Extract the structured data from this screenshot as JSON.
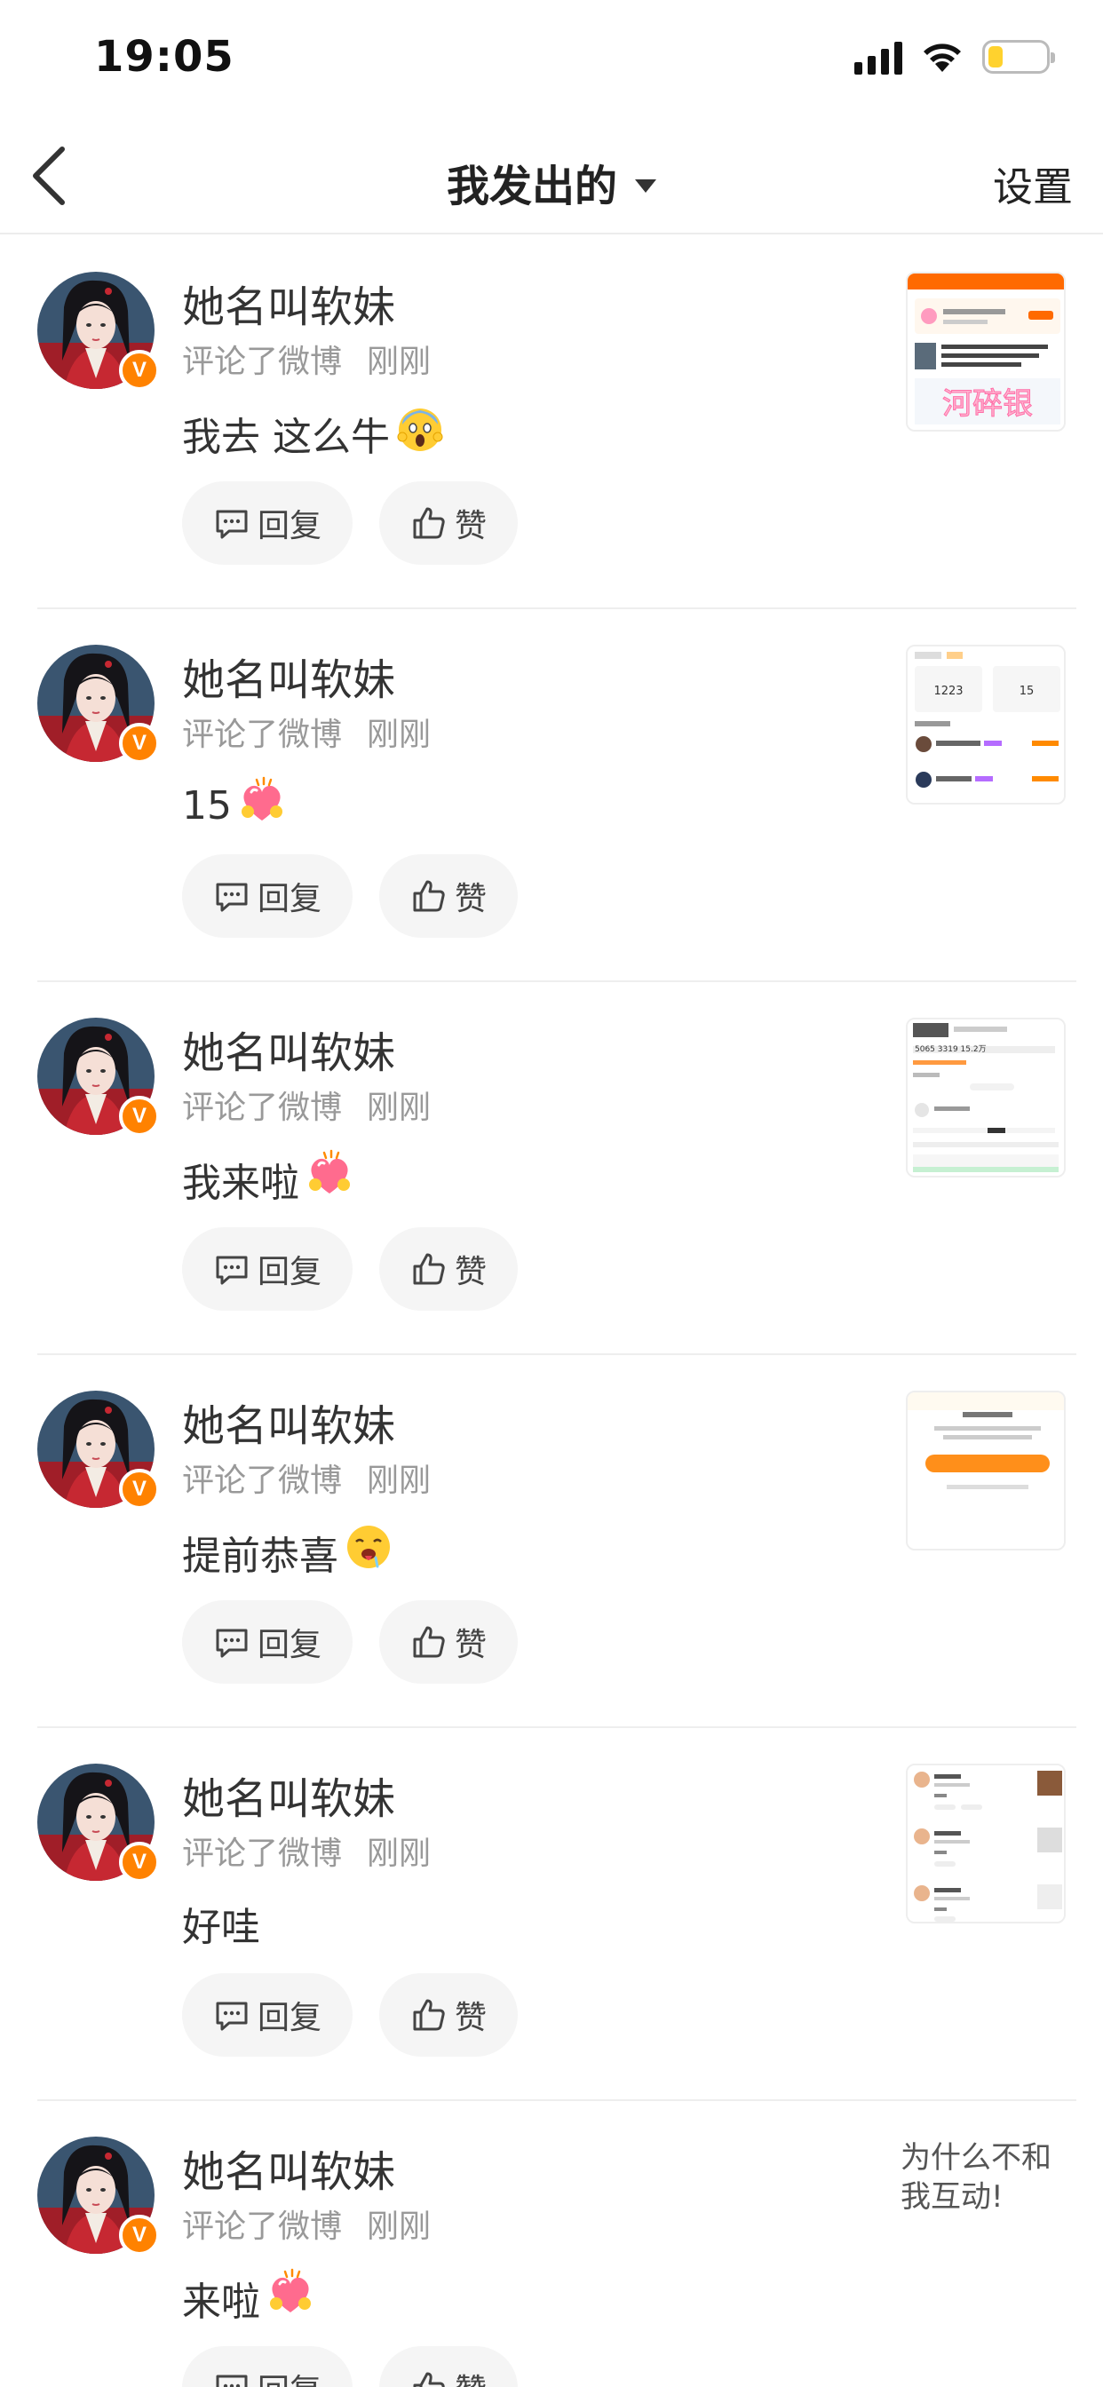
{
  "status_bar": {
    "time": "19:05"
  },
  "nav": {
    "title": "我发出的",
    "settings": "设置"
  },
  "items": [
    {
      "user": "她名叫软妹",
      "action": "评论了微博",
      "time": "刚刚",
      "comment": "我去 这么牛",
      "emoji": "scream-emoji",
      "reply": "回复",
      "like": "赞",
      "thumb": "screenshot",
      "thumb_watermark": "河碎银"
    },
    {
      "user": "她名叫软妹",
      "action": "评论了微博",
      "time": "刚刚",
      "comment": "15",
      "emoji": "heart-hug-emoji",
      "reply": "回复",
      "like": "赞",
      "thumb": "screenshot"
    },
    {
      "user": "她名叫软妹",
      "action": "评论了微博",
      "time": "刚刚",
      "comment": "我来啦",
      "emoji": "heart-hug-emoji",
      "reply": "回复",
      "like": "赞",
      "thumb": "screenshot"
    },
    {
      "user": "她名叫软妹",
      "action": "评论了微博",
      "time": "刚刚",
      "comment": "提前恭喜",
      "emoji": "drooling-emoji",
      "reply": "回复",
      "like": "赞",
      "thumb": "screenshot"
    },
    {
      "user": "她名叫软妹",
      "action": "评论了微博",
      "time": "刚刚",
      "comment": "好哇",
      "emoji": "",
      "reply": "回复",
      "like": "赞",
      "thumb": "screenshot"
    },
    {
      "user": "她名叫软妹",
      "action": "评论了微博",
      "time": "刚刚",
      "comment": "来啦",
      "emoji": "heart-hug-emoji",
      "reply": "回复",
      "like": "赞",
      "thumb_text": "为什么不和我互动!"
    }
  ],
  "colors": {
    "accent": "#ff8200",
    "badge": "#ff8200",
    "battery": "#ffd22e"
  }
}
